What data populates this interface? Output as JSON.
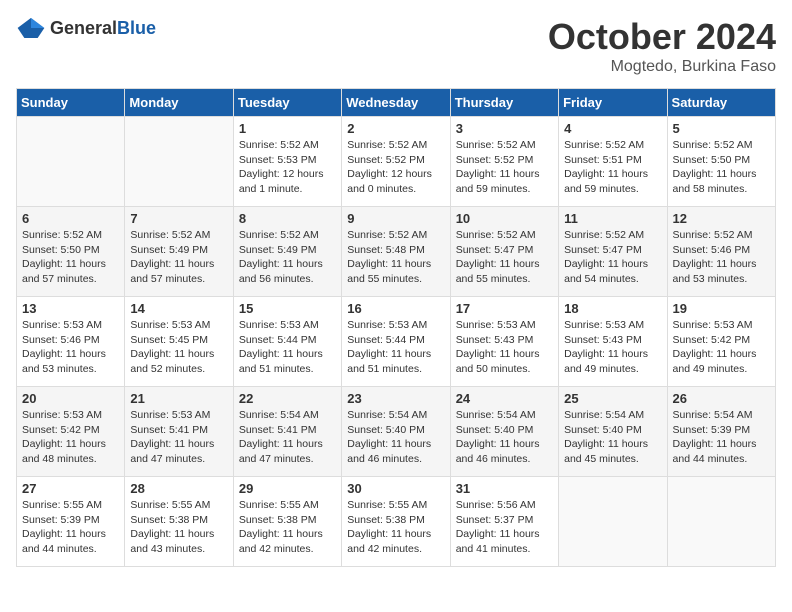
{
  "header": {
    "logo": {
      "general": "General",
      "blue": "Blue"
    },
    "title": "October 2024",
    "subtitle": "Mogtedo, Burkina Faso"
  },
  "weekdays": [
    "Sunday",
    "Monday",
    "Tuesday",
    "Wednesday",
    "Thursday",
    "Friday",
    "Saturday"
  ],
  "weeks": [
    [
      {
        "day": "",
        "text": ""
      },
      {
        "day": "",
        "text": ""
      },
      {
        "day": "1",
        "text": "Sunrise: 5:52 AM\nSunset: 5:53 PM\nDaylight: 12 hours and 1 minute."
      },
      {
        "day": "2",
        "text": "Sunrise: 5:52 AM\nSunset: 5:52 PM\nDaylight: 12 hours and 0 minutes."
      },
      {
        "day": "3",
        "text": "Sunrise: 5:52 AM\nSunset: 5:52 PM\nDaylight: 11 hours and 59 minutes."
      },
      {
        "day": "4",
        "text": "Sunrise: 5:52 AM\nSunset: 5:51 PM\nDaylight: 11 hours and 59 minutes."
      },
      {
        "day": "5",
        "text": "Sunrise: 5:52 AM\nSunset: 5:50 PM\nDaylight: 11 hours and 58 minutes."
      }
    ],
    [
      {
        "day": "6",
        "text": "Sunrise: 5:52 AM\nSunset: 5:50 PM\nDaylight: 11 hours and 57 minutes."
      },
      {
        "day": "7",
        "text": "Sunrise: 5:52 AM\nSunset: 5:49 PM\nDaylight: 11 hours and 57 minutes."
      },
      {
        "day": "8",
        "text": "Sunrise: 5:52 AM\nSunset: 5:49 PM\nDaylight: 11 hours and 56 minutes."
      },
      {
        "day": "9",
        "text": "Sunrise: 5:52 AM\nSunset: 5:48 PM\nDaylight: 11 hours and 55 minutes."
      },
      {
        "day": "10",
        "text": "Sunrise: 5:52 AM\nSunset: 5:47 PM\nDaylight: 11 hours and 55 minutes."
      },
      {
        "day": "11",
        "text": "Sunrise: 5:52 AM\nSunset: 5:47 PM\nDaylight: 11 hours and 54 minutes."
      },
      {
        "day": "12",
        "text": "Sunrise: 5:52 AM\nSunset: 5:46 PM\nDaylight: 11 hours and 53 minutes."
      }
    ],
    [
      {
        "day": "13",
        "text": "Sunrise: 5:53 AM\nSunset: 5:46 PM\nDaylight: 11 hours and 53 minutes."
      },
      {
        "day": "14",
        "text": "Sunrise: 5:53 AM\nSunset: 5:45 PM\nDaylight: 11 hours and 52 minutes."
      },
      {
        "day": "15",
        "text": "Sunrise: 5:53 AM\nSunset: 5:44 PM\nDaylight: 11 hours and 51 minutes."
      },
      {
        "day": "16",
        "text": "Sunrise: 5:53 AM\nSunset: 5:44 PM\nDaylight: 11 hours and 51 minutes."
      },
      {
        "day": "17",
        "text": "Sunrise: 5:53 AM\nSunset: 5:43 PM\nDaylight: 11 hours and 50 minutes."
      },
      {
        "day": "18",
        "text": "Sunrise: 5:53 AM\nSunset: 5:43 PM\nDaylight: 11 hours and 49 minutes."
      },
      {
        "day": "19",
        "text": "Sunrise: 5:53 AM\nSunset: 5:42 PM\nDaylight: 11 hours and 49 minutes."
      }
    ],
    [
      {
        "day": "20",
        "text": "Sunrise: 5:53 AM\nSunset: 5:42 PM\nDaylight: 11 hours and 48 minutes."
      },
      {
        "day": "21",
        "text": "Sunrise: 5:53 AM\nSunset: 5:41 PM\nDaylight: 11 hours and 47 minutes."
      },
      {
        "day": "22",
        "text": "Sunrise: 5:54 AM\nSunset: 5:41 PM\nDaylight: 11 hours and 47 minutes."
      },
      {
        "day": "23",
        "text": "Sunrise: 5:54 AM\nSunset: 5:40 PM\nDaylight: 11 hours and 46 minutes."
      },
      {
        "day": "24",
        "text": "Sunrise: 5:54 AM\nSunset: 5:40 PM\nDaylight: 11 hours and 46 minutes."
      },
      {
        "day": "25",
        "text": "Sunrise: 5:54 AM\nSunset: 5:40 PM\nDaylight: 11 hours and 45 minutes."
      },
      {
        "day": "26",
        "text": "Sunrise: 5:54 AM\nSunset: 5:39 PM\nDaylight: 11 hours and 44 minutes."
      }
    ],
    [
      {
        "day": "27",
        "text": "Sunrise: 5:55 AM\nSunset: 5:39 PM\nDaylight: 11 hours and 44 minutes."
      },
      {
        "day": "28",
        "text": "Sunrise: 5:55 AM\nSunset: 5:38 PM\nDaylight: 11 hours and 43 minutes."
      },
      {
        "day": "29",
        "text": "Sunrise: 5:55 AM\nSunset: 5:38 PM\nDaylight: 11 hours and 42 minutes."
      },
      {
        "day": "30",
        "text": "Sunrise: 5:55 AM\nSunset: 5:38 PM\nDaylight: 11 hours and 42 minutes."
      },
      {
        "day": "31",
        "text": "Sunrise: 5:56 AM\nSunset: 5:37 PM\nDaylight: 11 hours and 41 minutes."
      },
      {
        "day": "",
        "text": ""
      },
      {
        "day": "",
        "text": ""
      }
    ]
  ]
}
